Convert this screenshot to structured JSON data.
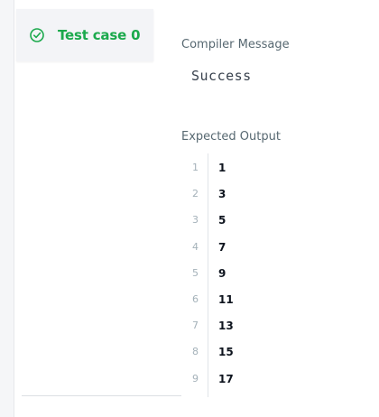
{
  "colors": {
    "success": "#1ba94c",
    "tab_background": "#f3f4f7",
    "text_primary": "#0e141e",
    "text_muted": "#576871",
    "line_number": "#a4b1b9"
  },
  "testcase_tab": {
    "icon": "check-circle-icon",
    "label": "Test case 0"
  },
  "compiler_section": {
    "title": "Compiler Message",
    "message": "Success"
  },
  "expected_output": {
    "title": "Expected Output",
    "lines": [
      {
        "number": "1",
        "value": "1"
      },
      {
        "number": "2",
        "value": "3"
      },
      {
        "number": "3",
        "value": "5"
      },
      {
        "number": "4",
        "value": "7"
      },
      {
        "number": "5",
        "value": "9"
      },
      {
        "number": "6",
        "value": "11"
      },
      {
        "number": "7",
        "value": "13"
      },
      {
        "number": "8",
        "value": "15"
      },
      {
        "number": "9",
        "value": "17"
      }
    ]
  }
}
